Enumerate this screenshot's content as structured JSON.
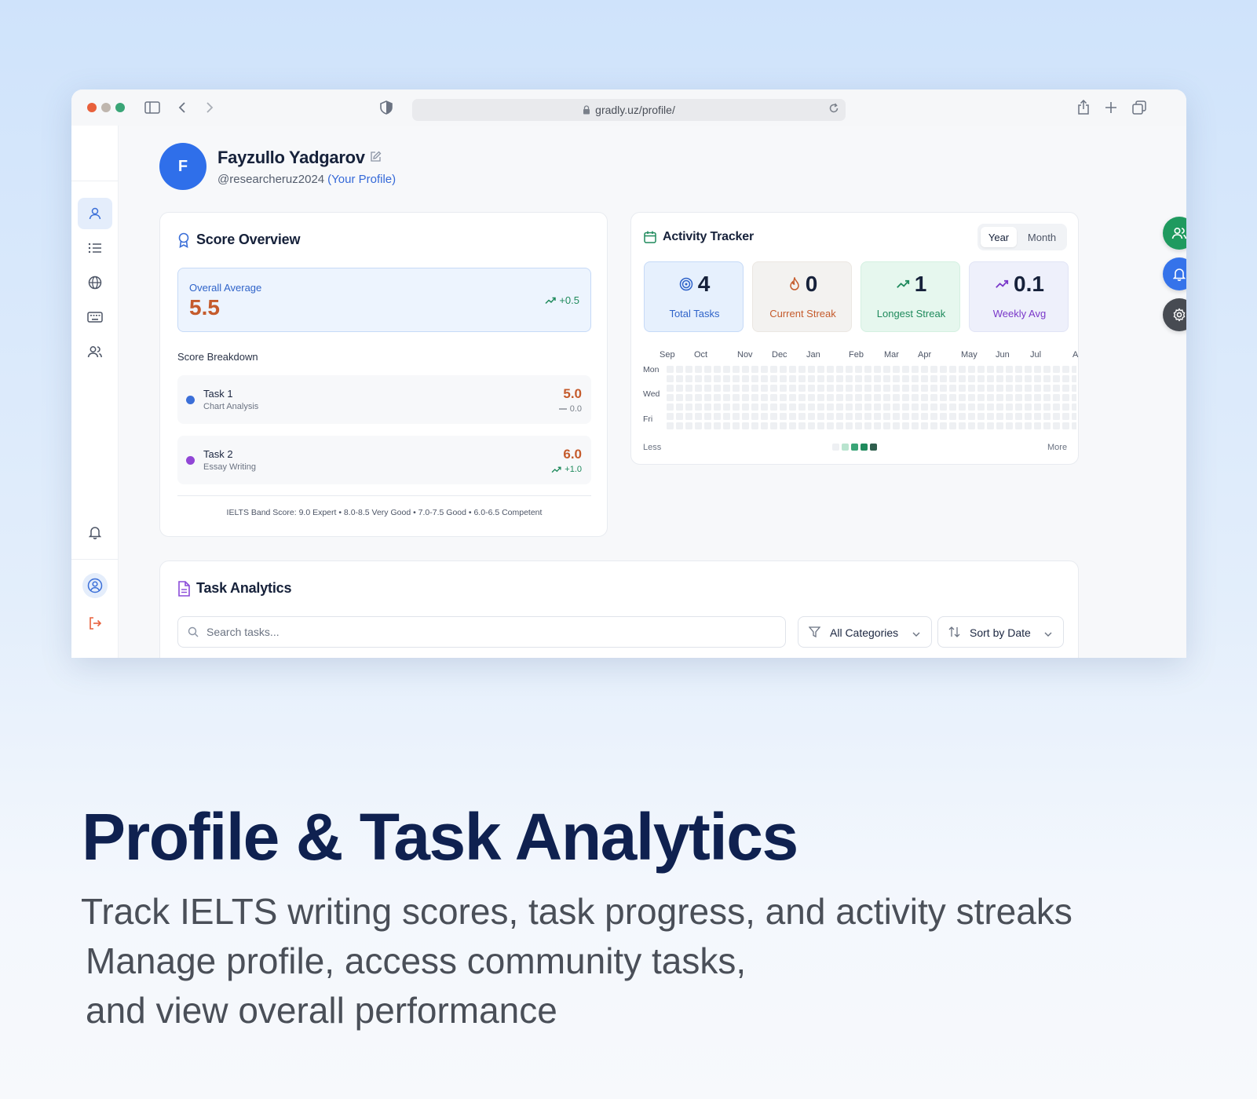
{
  "browser": {
    "url": "gradly.uz/profile/"
  },
  "profile": {
    "avatar_letter": "F",
    "name": "Fayzullo Yadgarov",
    "handle": "@researcheruz2024",
    "own_label": "(Your Profile)"
  },
  "score_overview": {
    "title": "Score Overview",
    "overall_label": "Overall Average",
    "overall_value": "5.5",
    "overall_trend": "+0.5",
    "breakdown_title": "Score Breakdown",
    "tasks": [
      {
        "name": "Task 1",
        "subtitle": "Chart Analysis",
        "score": "5.0",
        "delta": "0.0",
        "bullet_color": "#3b6fd8",
        "delta_color": "#7a808a"
      },
      {
        "name": "Task 2",
        "subtitle": "Essay Writing",
        "score": "6.0",
        "delta": "+1.0",
        "bullet_color": "#9146d6",
        "delta_color": "#1f8a5c"
      }
    ],
    "band_text": "IELTS Band Score: 9.0 Expert • 8.0-8.5 Very Good • 7.0-7.5 Good • 6.0-6.5 Competent"
  },
  "activity": {
    "title": "Activity Tracker",
    "toggle": [
      "Year",
      "Month"
    ],
    "active_toggle": "Year",
    "stats": [
      {
        "value": "4",
        "label": "Total Tasks",
        "icon": "target-icon",
        "bg": "#e6f0fd",
        "border": "#c6daf7",
        "color": "#2f63c9"
      },
      {
        "value": "0",
        "label": "Current Streak",
        "icon": "flame-icon",
        "bg": "#f3f2f0",
        "border": "#ebe7e2",
        "color": "#c55b2c"
      },
      {
        "value": "1",
        "label": "Longest Streak",
        "icon": "trend-up-icon",
        "bg": "#e6f7ee",
        "border": "#d4f0e1",
        "color": "#1f8a5c"
      },
      {
        "value": "0.1",
        "label": "Weekly Avg",
        "icon": "trend-up-icon",
        "bg": "#eef0fb",
        "border": "#e1e4f5",
        "color": "#7a38c9"
      }
    ],
    "months": [
      "Sep",
      "Oct",
      "Nov",
      "Dec",
      "Jan",
      "Feb",
      "Mar",
      "Apr",
      "May",
      "Jun",
      "Jul",
      "A"
    ],
    "days": [
      "Mon",
      "Wed",
      "Fri"
    ],
    "legend_less": "Less",
    "legend_more": "More",
    "legend_colors": [
      "#eef0f3",
      "#b9e4cf",
      "#3aa577",
      "#1f8a5c",
      "#2f5e4d"
    ]
  },
  "task_analytics": {
    "title": "Task Analytics",
    "search_placeholder": "Search tasks...",
    "category_filter": "All Categories",
    "sort": "Sort by Date"
  },
  "marketing": {
    "headline": "Profile & Task Analytics",
    "lines": [
      "Track IELTS writing scores, task progress, and activity streaks",
      "Manage profile, access community tasks,",
      "and view overall performance"
    ]
  }
}
